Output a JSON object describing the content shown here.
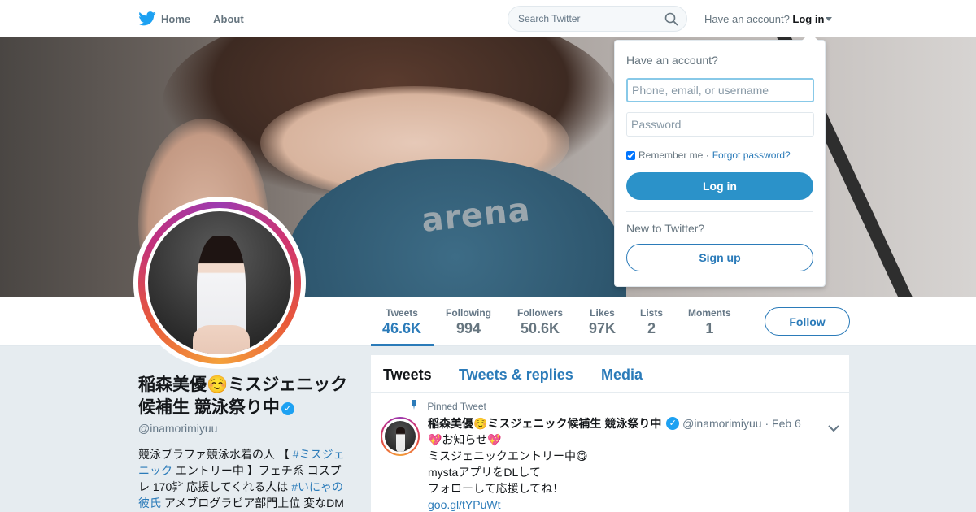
{
  "nav": {
    "home_label": "Home",
    "about_label": "About",
    "search_placeholder": "Search Twitter",
    "account_prompt": "Have an account?",
    "login_label": "Log in"
  },
  "colors": {
    "link_blue": "#2b7bb9",
    "brand_blue": "#1da1f2",
    "login_button": "#2b92c9"
  },
  "icons": [
    "twitter-bird-icon",
    "search-icon",
    "caret-down-icon",
    "verified-badge-icon",
    "pin-icon",
    "chevron-down-icon"
  ],
  "banner": {
    "brand_text": "arena"
  },
  "profile": {
    "name_line": "稲森美優☺️ミスジェニック候補生 競泳祭り中",
    "verified_mark": "✓",
    "handle": "@inamorimiyuu",
    "bio": {
      "part1": "競泳ブラファ競泳水着の人 【 ",
      "hashtag1": "#ミスジェニック",
      "part2": " エントリー中 】フェチ系 コスプレ 170㌢ 応援してくれる人は ",
      "hashtag2": "#いにゃの彼氏",
      "part3": " アメブログラビア部門上位 変なDM"
    },
    "follow_label": "Follow"
  },
  "stats": [
    {
      "label": "Tweets",
      "value": "46.6K"
    },
    {
      "label": "Following",
      "value": "994"
    },
    {
      "label": "Followers",
      "value": "50.6K"
    },
    {
      "label": "Likes",
      "value": "97K"
    },
    {
      "label": "Lists",
      "value": "2"
    },
    {
      "label": "Moments",
      "value": "1"
    }
  ],
  "timeline": {
    "tabs": [
      "Tweets",
      "Tweets & replies",
      "Media"
    ],
    "active_tab": "Tweets"
  },
  "pinned_tweet": {
    "pin_label": "Pinned Tweet",
    "author_name": "稲森美優☺️ミスジェニック候補生 競泳祭り中",
    "handle": "@inamorimiyuu",
    "date": "· Feb 6",
    "lines": [
      "💖お知らせ💖",
      "ミスジェニックエントリー中😋",
      "mystaアプリをDLして",
      "フォローして応援してね！"
    ],
    "link": "goo.gl/tYPuWt"
  },
  "login_popup": {
    "title": "Have an account?",
    "username_placeholder": "Phone, email, or username",
    "password_placeholder": "Password",
    "remember_label": "Remember me ·",
    "remember_checked": true,
    "forgot_label": "Forgot password?",
    "login_button": "Log in",
    "new_title": "New to Twitter?",
    "signup_button": "Sign up"
  }
}
